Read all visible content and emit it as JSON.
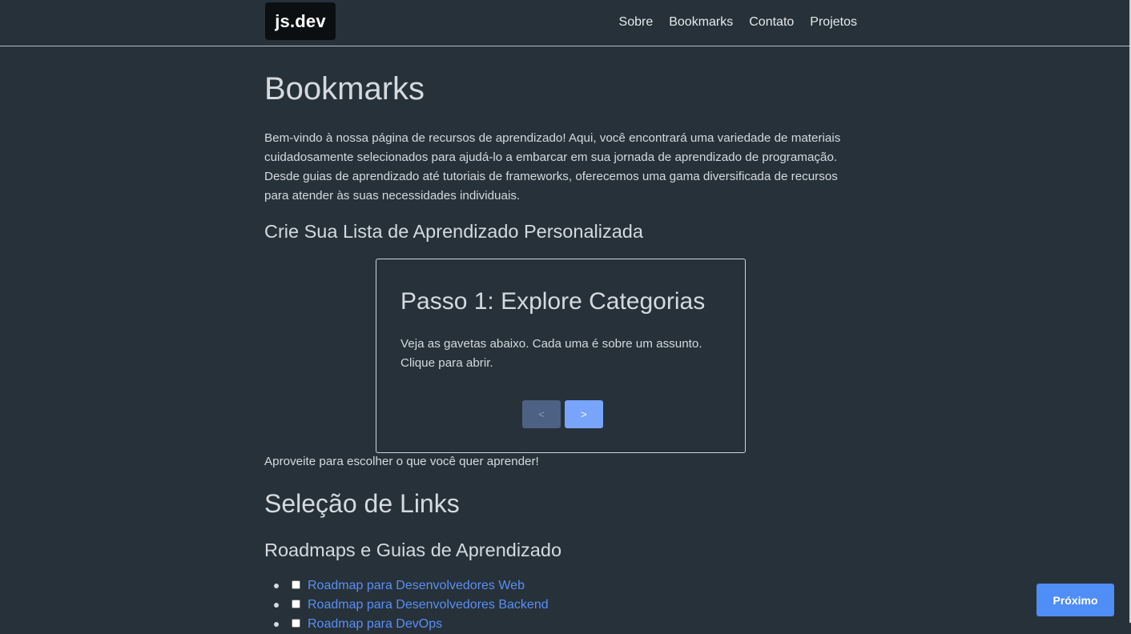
{
  "header": {
    "logo": "js.dev",
    "nav": [
      "Sobre",
      "Bookmarks",
      "Contato",
      "Projetos"
    ]
  },
  "main": {
    "title": "Bookmarks",
    "intro": "Bem-vindo à nossa página de recursos de aprendizado! Aqui, você encontrará uma variedade de materiais cuidadosamente selecionados para ajudá-lo a embarcar em sua jornada de aprendizado de programação. Desde guias de aprendizado até tutoriais de frameworks, oferecemos uma gama diversificada de recursos para atender às suas necessidades individuais.",
    "custom_list_heading": "Crie Sua Lista de Aprendizado Personalizada",
    "stepper": {
      "title": "Passo 1: Explore Categorias",
      "text": "Veja as gavetas abaixo. Cada uma é sobre um assunto. Clique para abrir.",
      "prev_label": "<",
      "next_label": ">"
    },
    "after_text": "Aproveite para escolher o que você quer aprender!",
    "links_heading": "Seleção de Links",
    "roadmaps_heading": "Roadmaps e Guias de Aprendizado",
    "links": [
      "Roadmap para Desenvolvedores Web",
      "Roadmap para Desenvolvedores Backend",
      "Roadmap para DevOps"
    ]
  },
  "floating": {
    "next_label": "Próximo"
  },
  "colors": {
    "background": "#263139",
    "link": "#5b8ff5",
    "accent_button": "#4f8df7"
  }
}
